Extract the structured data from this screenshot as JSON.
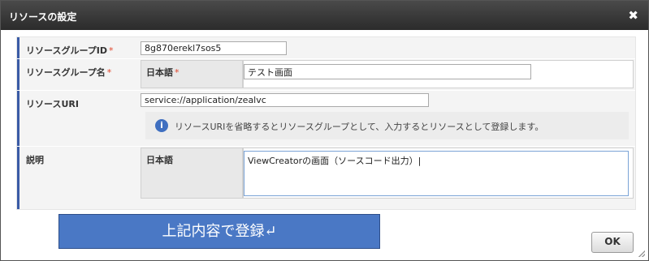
{
  "dialog": {
    "title": "リソースの設定",
    "close_glyph": "✖"
  },
  "form": {
    "group_id": {
      "label": "リソースグループID",
      "required_mark": "*",
      "value": "8g870erekl7sos5"
    },
    "group_name": {
      "label": "リソースグループ名",
      "required_mark": "*",
      "lang_label": "日本語",
      "lang_required_mark": "*",
      "value": "テスト画面"
    },
    "resource_uri": {
      "label": "リソースURI",
      "value": "service://application/zealvc",
      "info_icon": "info-icon",
      "info_text": "リソースURIを省略するとリソースグループとして、入力するとリソースとして登録します。"
    },
    "description": {
      "label": "説明",
      "lang_label": "日本語",
      "value": "ViewCreatorの画面（ソースコード出力）|"
    }
  },
  "banner": {
    "text": "上記内容で登録↵"
  },
  "buttons": {
    "ok": "OK"
  },
  "colors": {
    "titlebar": "#2b2b2b",
    "accent_border": "#3a5ba6",
    "required": "#e0452b",
    "banner": "#4a78c5",
    "info_icon": "#3f6fc0"
  }
}
